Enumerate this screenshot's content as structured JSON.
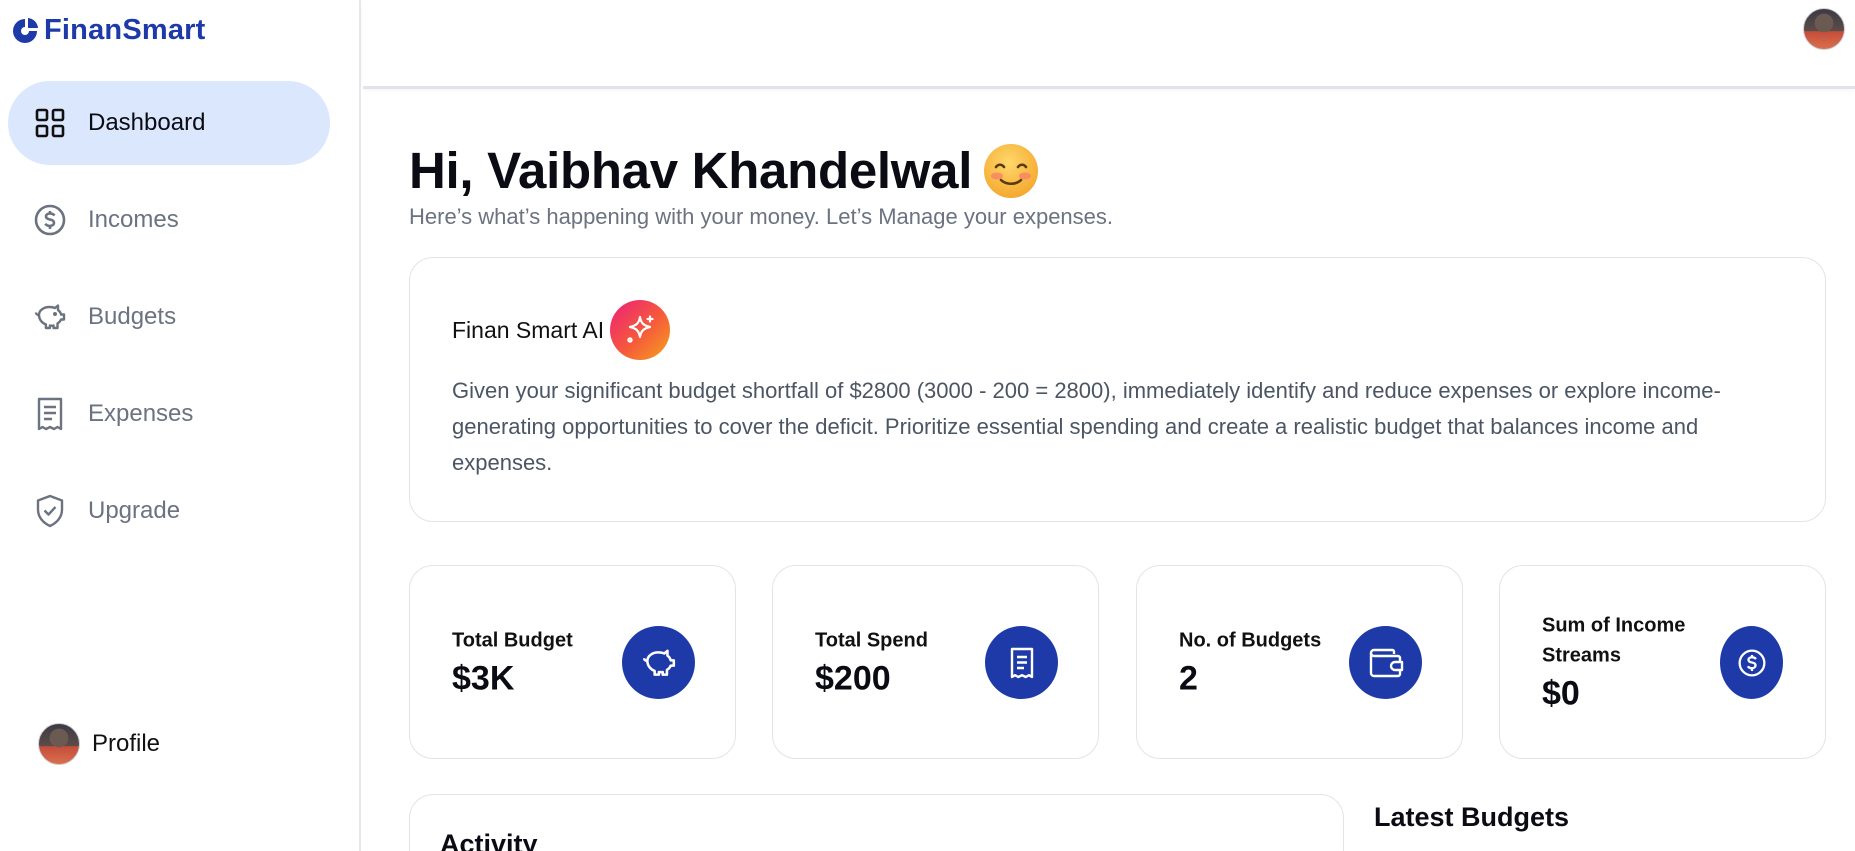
{
  "brand": {
    "name": "FinanSmart"
  },
  "sidebar": {
    "items": [
      {
        "label": "Dashboard",
        "icon": "dashboard-grid-icon",
        "active": true
      },
      {
        "label": "Incomes",
        "icon": "dollar-circle-icon",
        "active": false
      },
      {
        "label": "Budgets",
        "icon": "piggy-bank-icon",
        "active": false
      },
      {
        "label": "Expenses",
        "icon": "receipt-icon",
        "active": false
      },
      {
        "label": "Upgrade",
        "icon": "shield-check-icon",
        "active": false
      }
    ],
    "profile_label": "Profile"
  },
  "header": {
    "greeting": "Hi, Vaibhav Khandelwal",
    "subtitle": "Here’s what’s happening with your money. Let’s Manage your expenses."
  },
  "ai": {
    "title": "Finan Smart AI",
    "message": "Given your significant budget shortfall of $2800 (3000 - 200 = 2800), immediately identify and reduce expenses or explore income-generating opportunities to cover the deficit. Prioritize essential spending and create a realistic budget that balances income and expenses."
  },
  "stats": [
    {
      "label": "Total Budget",
      "value": "$3K",
      "icon": "piggy-bank-icon"
    },
    {
      "label": "Total Spend",
      "value": "$200",
      "icon": "receipt-icon"
    },
    {
      "label": "No. of Budgets",
      "value": "2",
      "icon": "wallet-icon"
    },
    {
      "label": "Sum of Income Streams",
      "value": "$0",
      "icon": "dollar-circle-icon"
    }
  ],
  "sections": {
    "activity": "Activity",
    "latest_budgets": "Latest Budgets"
  },
  "colors": {
    "brand": "#1e3aa8",
    "active_nav_bg": "#dbe7fd",
    "muted_text": "#6b7280"
  }
}
